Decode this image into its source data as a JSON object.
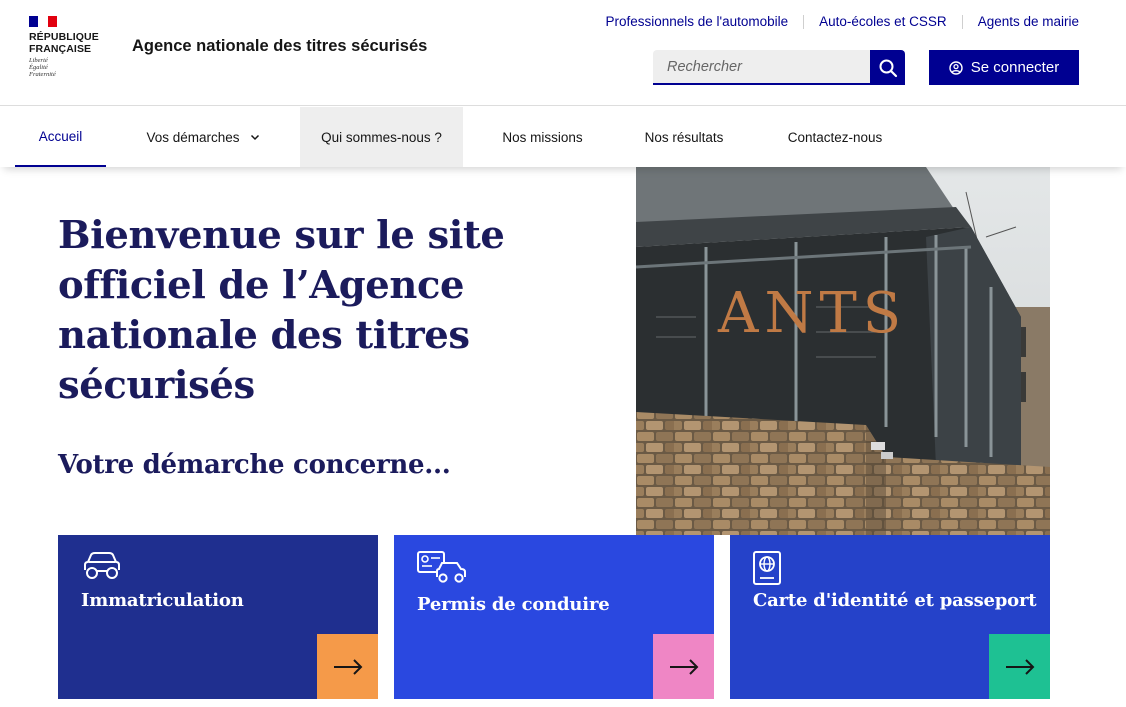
{
  "header": {
    "logo": {
      "line1": "RÉPUBLIQUE",
      "line2": "FRANÇAISE",
      "motto": [
        "Liberté",
        "Égalité",
        "Fraternité"
      ]
    },
    "agency_name": "Agence nationale des titres sécurisés",
    "top_links": [
      "Professionnels de l'automobile",
      "Auto-écoles et CSSR",
      "Agents de mairie"
    ],
    "search": {
      "placeholder": "Rechercher",
      "icon": "search-icon"
    },
    "login_label": "Se connecter"
  },
  "nav": {
    "items": [
      "Accueil",
      "Vos démarches",
      "Qui sommes-nous ?",
      "Nos missions",
      "Nos résultats",
      "Contactez-nous"
    ],
    "active": "Accueil",
    "hovered": "Qui sommes-nous ?"
  },
  "hero": {
    "title_lines": [
      "Bienvenue sur le site",
      "officiel de l’Agence",
      "nationale des titres",
      "sécurisés"
    ],
    "subtitle": "Votre démarche concerne...",
    "photo_sign": "ANTS"
  },
  "cards": [
    {
      "label": "Immatriculation",
      "icon": "car-icon",
      "bg": "#1f2f8f",
      "accent": "#f59a49"
    },
    {
      "label": "Permis de conduire",
      "icon": "driving-license-icon",
      "bg": "#2a48e0",
      "accent": "#ef86c5"
    },
    {
      "label": "Carte d'identité et passeport",
      "icon": "passport-icon",
      "bg": "#2542c9",
      "accent": "#1ec193"
    }
  ],
  "colors": {
    "primary": "#000091",
    "title": "#1b1b5c",
    "flag_blue": "#000091",
    "flag_red": "#e1000f"
  }
}
